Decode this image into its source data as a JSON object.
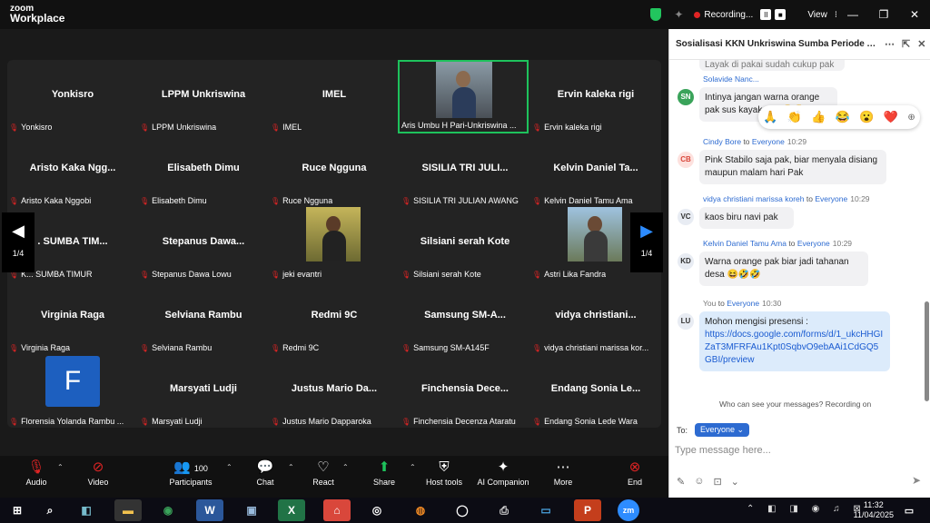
{
  "app": {
    "logo_line1": "zoom",
    "logo_line2": "Workplace"
  },
  "titlebar": {
    "recording": "Recording...",
    "pause": "II",
    "stop": "■",
    "view": "View",
    "view_caret": "⁝",
    "minimize": "—",
    "restore": "❐",
    "close": "✕"
  },
  "gallery": {
    "page_left": "1/4",
    "page_right": "1/4",
    "arrow_left": "◀",
    "arrow_right": "▶",
    "tiles": [
      {
        "big": "Yonkisro",
        "label": "Yonkisro"
      },
      {
        "big": "LPPM Unkriswina",
        "label": "LPPM Unkriswina"
      },
      {
        "big": "IMEL",
        "label": "IMEL"
      },
      {
        "big": "",
        "label": "Aris Umbu H Pari-Unkriswina ..."
      },
      {
        "big": "Ervin kaleka rigi",
        "label": "Ervin kaleka rigi"
      },
      {
        "big": "Aristo Kaka Ngg...",
        "label": "Aristo Kaka Nggobi"
      },
      {
        "big": "Elisabeth Dimu",
        "label": "Elisabeth Dimu"
      },
      {
        "big": "Ruce Ngguna",
        "label": "Ruce Ngguna"
      },
      {
        "big": "SISILIA TRI JULI...",
        "label": "SISILIA TRI JULIAN AWANG"
      },
      {
        "big": "Kelvin Daniel Ta...",
        "label": "Kelvin Daniel Tamu Ama"
      },
      {
        "big": ". SUMBA TIM...",
        "label": "K... SUMBA TIMUR"
      },
      {
        "big": "Stepanus Dawa...",
        "label": "Stepanus Dawa Lowu"
      },
      {
        "big": "",
        "label": "jeki evantri"
      },
      {
        "big": "Silsiani serah Kote",
        "label": "Silsiani serah Kote"
      },
      {
        "big": "",
        "label": "Astri Lika Fandra"
      },
      {
        "big": "Virginia Raga",
        "label": "Virginia Raga"
      },
      {
        "big": "Selviana Rambu",
        "label": "Selviana Rambu"
      },
      {
        "big": "Redmi 9C",
        "label": "Redmi 9C"
      },
      {
        "big": "Samsung SM-A...",
        "label": "Samsung SM-A145F"
      },
      {
        "big": "vidya christiani...",
        "label": "vidya christiani marissa kor..."
      },
      {
        "big": "",
        "label": "Florensia Yolanda Rambu ..."
      },
      {
        "big": "Marsyati Ludji",
        "label": "Marsyati Ludji"
      },
      {
        "big": "Justus Mario Da...",
        "label": "Justus Mario Dapparoka"
      },
      {
        "big": "Finchensia Dece...",
        "label": "Finchensia Decenza Ataratu"
      },
      {
        "big": "Endang Sonia Le...",
        "label": "Endang Sonia Lede Wara"
      }
    ],
    "avatar_f": "F",
    "mic_icon": "✕"
  },
  "toolbar": {
    "audio": "Audio",
    "video": "Video",
    "participants": "Participants",
    "participants_count": "100",
    "chat": "Chat",
    "react": "React",
    "share": "Share",
    "host_tools": "Host tools",
    "ai_companion": "AI Companion",
    "more": "More",
    "end": "End"
  },
  "chat": {
    "title": "Sosialisasi KKN Unkriswina Sumba Periode A...",
    "top_partial": "Layak di pakai sudah cukup pak",
    "reactions": [
      "🙏",
      "👏",
      "👍",
      "😂",
      "😮",
      "❤️"
    ],
    "messages": [
      {
        "initials": "SN",
        "sender": "Solavide Nanc...",
        "to": "",
        "recipient": "",
        "time": "",
        "text": "Intinya jangan warna orange pak sus kayak napi😭😭",
        "color": "#3aa35a"
      },
      {
        "initials": "CB",
        "sender": "Cindy Bore",
        "to": "to",
        "recipient": "Everyone",
        "time": "10:29",
        "text": "Pink Stabilo saja pak, biar menyala disiang maupun malam hari Pak",
        "color": "#d9473b"
      },
      {
        "initials": "VC",
        "sender": "vidya christiani marissa koreh",
        "to": "to",
        "recipient": "Everyone",
        "time": "10:29",
        "text": "kaos biru navi pak",
        "color": "#444"
      },
      {
        "initials": "KD",
        "sender": "Kelvin Daniel Tamu Ama",
        "to": "to",
        "recipient": "Everyone",
        "time": "10:29",
        "text": "Warna orange pak biar jadi tahanan desa 😆🤣🤣",
        "color": "#555"
      },
      {
        "initials": "LU",
        "sender": "You",
        "to": "to",
        "recipient": "Everyone",
        "time": "10:30",
        "text": "Mohon mengisi presensi :",
        "link": "https://docs.google.com/forms/d/1_ukcHHGIZaT3MFRFAu1Kpt0SqbvO9ebAAi1CdGQ5GBI/preview",
        "color": "#2d6bd1"
      }
    ],
    "hint": "Who can see your messages? Recording on",
    "to_label": "To:",
    "to_value": "Everyone",
    "composer_placeholder": "Type message here..."
  },
  "taskbar": {
    "time": "11:32",
    "date": "11/04/2025"
  }
}
